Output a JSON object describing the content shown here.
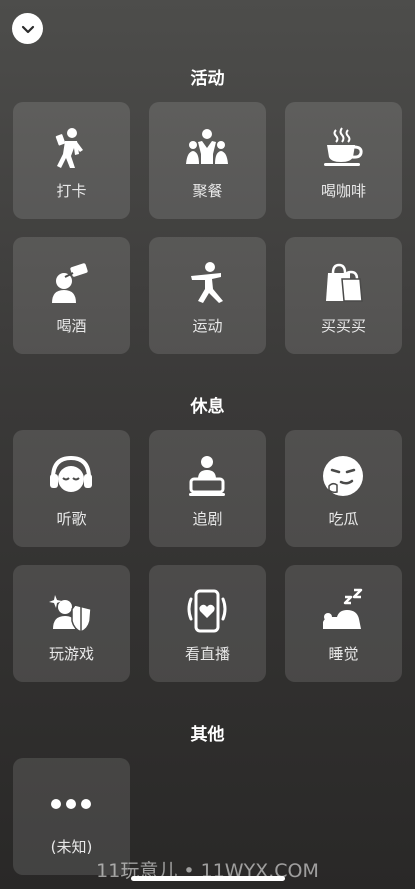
{
  "header": {
    "collapse_icon": "chevron-down-icon"
  },
  "sections": [
    {
      "title": "活动",
      "items": [
        {
          "label": "打卡",
          "icon": "check-in-person-icon"
        },
        {
          "label": "聚餐",
          "icon": "group-dining-icon"
        },
        {
          "label": "喝咖啡",
          "icon": "coffee-cup-icon"
        },
        {
          "label": "喝酒",
          "icon": "drinking-icon"
        },
        {
          "label": "运动",
          "icon": "exercise-icon"
        },
        {
          "label": "买买买",
          "icon": "shopping-bags-icon"
        }
      ]
    },
    {
      "title": "休息",
      "items": [
        {
          "label": "听歌",
          "icon": "headphones-face-icon"
        },
        {
          "label": "追剧",
          "icon": "watching-tv-icon"
        },
        {
          "label": "吃瓜",
          "icon": "smirk-face-icon"
        },
        {
          "label": "玩游戏",
          "icon": "gaming-shield-icon"
        },
        {
          "label": "看直播",
          "icon": "live-phone-heart-icon"
        },
        {
          "label": "睡觉",
          "icon": "sleeping-icon"
        }
      ]
    },
    {
      "title": "其他",
      "items": [
        {
          "label": "(未知)",
          "icon": "more-dots-icon"
        }
      ]
    }
  ],
  "watermark": "11玩意儿 • 11WYX.COM"
}
